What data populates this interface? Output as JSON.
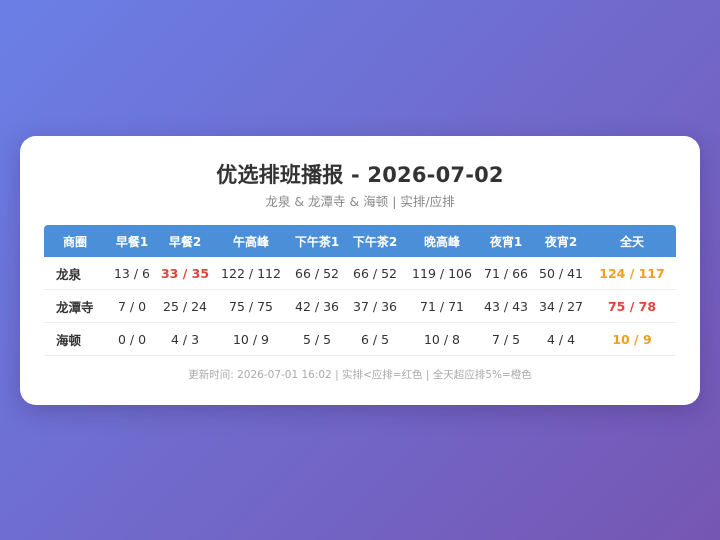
{
  "report": {
    "title": "优选排班播报 - 2026-07-02",
    "subtitle": "龙泉 & 龙潭寺 & 海顿 | 实排/应排",
    "footer": "更新时间: 2026-07-01 16:02 | 实排<应排=红色 | 全天超应排5%=橙色"
  },
  "colors": {
    "header_bg": "#4b8fd8",
    "red": "#e0453a",
    "orange": "#f0a020"
  },
  "table": {
    "headers": [
      "商圈",
      "早餐1",
      "早餐2",
      "午高峰",
      "下午茶1",
      "下午茶2",
      "晚高峰",
      "夜宵1",
      "夜宵2",
      "全天"
    ],
    "rows": [
      {
        "name": "龙泉",
        "cells": [
          {
            "v": "13 / 6",
            "s": ""
          },
          {
            "v": "33 / 35",
            "s": "red"
          },
          {
            "v": "122 / 112",
            "s": ""
          },
          {
            "v": "66 / 52",
            "s": ""
          },
          {
            "v": "66 / 52",
            "s": ""
          },
          {
            "v": "119 / 106",
            "s": ""
          },
          {
            "v": "71 / 66",
            "s": ""
          },
          {
            "v": "50 / 41",
            "s": ""
          },
          {
            "v": "124 / 117",
            "s": "orange"
          }
        ]
      },
      {
        "name": "龙潭寺",
        "cells": [
          {
            "v": "7 / 0",
            "s": ""
          },
          {
            "v": "25 / 24",
            "s": ""
          },
          {
            "v": "75 / 75",
            "s": ""
          },
          {
            "v": "42 / 36",
            "s": ""
          },
          {
            "v": "37 / 36",
            "s": ""
          },
          {
            "v": "71 / 71",
            "s": ""
          },
          {
            "v": "43 / 43",
            "s": ""
          },
          {
            "v": "34 / 27",
            "s": ""
          },
          {
            "v": "75 / 78",
            "s": "red"
          }
        ]
      },
      {
        "name": "海顿",
        "cells": [
          {
            "v": "0 / 0",
            "s": ""
          },
          {
            "v": "4 / 3",
            "s": ""
          },
          {
            "v": "10 / 9",
            "s": ""
          },
          {
            "v": "5 / 5",
            "s": ""
          },
          {
            "v": "6 / 5",
            "s": ""
          },
          {
            "v": "10 / 8",
            "s": ""
          },
          {
            "v": "7 / 5",
            "s": ""
          },
          {
            "v": "4 / 4",
            "s": ""
          },
          {
            "v": "10 / 9",
            "s": "orange"
          }
        ]
      }
    ]
  }
}
